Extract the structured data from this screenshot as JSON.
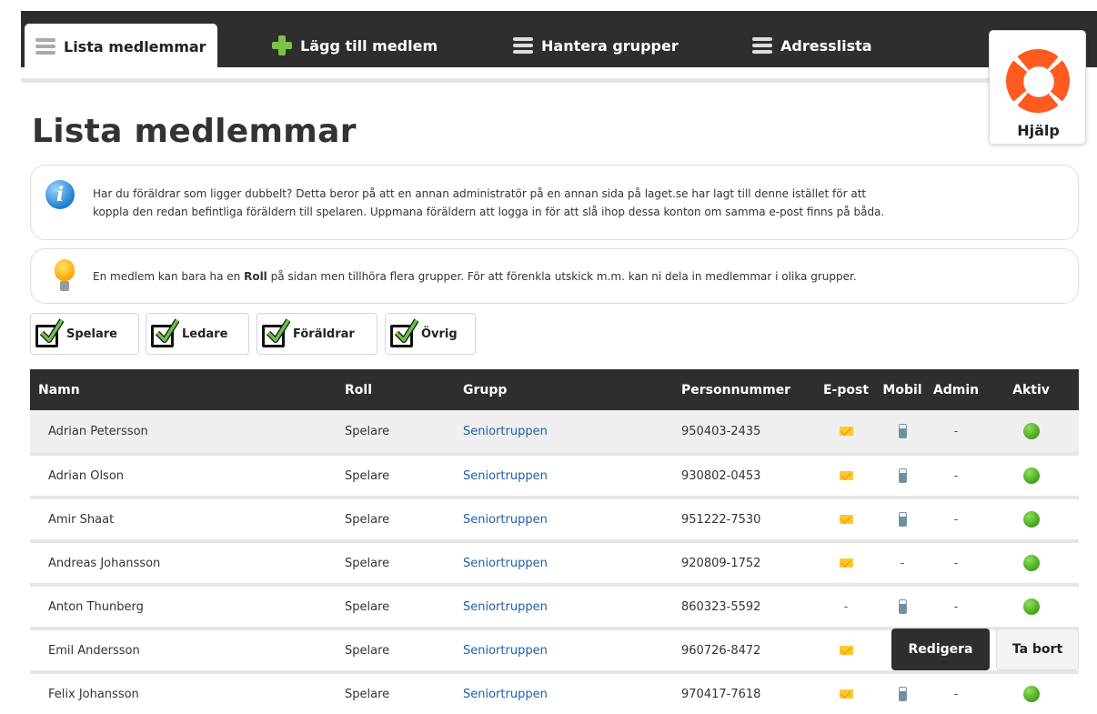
{
  "nav": {
    "tabs": [
      {
        "label": "Lista medlemmar",
        "icon": "list-icon"
      },
      {
        "label": "Lägg till medlem",
        "icon": "plus-icon"
      },
      {
        "label": "Hantera grupper",
        "icon": "list-icon"
      },
      {
        "label": "Adresslista",
        "icon": "list-icon"
      }
    ]
  },
  "help": {
    "label": "Hjälp",
    "icon": "lifebuoy-icon"
  },
  "page": {
    "title": "Lista medlemmar"
  },
  "notices": {
    "info": {
      "line1": "Har du föräldrar som ligger dubbelt? Detta beror på att en annan administratör på en annan sida på laget.se har lagt till denne istället för att",
      "line2": "koppla den redan befintliga föräldern till spelaren. Uppmana föräldern att logga in för att slå ihop dessa konton om samma e-post finns på båda."
    },
    "tip": {
      "before": "En medlem kan bara ha en ",
      "bold": "Roll",
      "after": " på sidan men tillhöra flera grupper. För att förenkla utskick m.m. kan ni dela in medlemmar i olika grupper."
    }
  },
  "filters": [
    "Spelare",
    "Ledare",
    "Föräldrar",
    "Övrig"
  ],
  "table": {
    "headers": {
      "name": "Namn",
      "roll": "Roll",
      "grupp": "Grupp",
      "pnr": "Personnummer",
      "epost": "E-post",
      "mobil": "Mobil",
      "admin": "Admin",
      "aktiv": "Aktiv"
    },
    "rows": [
      {
        "name": "Adrian Petersson",
        "roll": "Spelare",
        "grupp": "Seniortruppen",
        "pnr": "950403-2435",
        "epost": "envelope-icon",
        "mobil": "phone-icon",
        "admin": "-",
        "aktiv": "green-dot-icon"
      },
      {
        "name": "Adrian Olson",
        "roll": "Spelare",
        "grupp": "Seniortruppen",
        "pnr": "930802-0453",
        "epost": "envelope-icon",
        "mobil": "phone-icon",
        "admin": "-",
        "aktiv": "green-dot-icon"
      },
      {
        "name": "Amir Shaat",
        "roll": "Spelare",
        "grupp": "Seniortruppen",
        "pnr": "951222-7530",
        "epost": "envelope-icon",
        "mobil": "phone-icon",
        "admin": "-",
        "aktiv": "green-dot-icon"
      },
      {
        "name": "Andreas Johansson",
        "roll": "Spelare",
        "grupp": "Seniortruppen",
        "pnr": "920809-1752",
        "epost": "envelope-icon",
        "mobil": "-",
        "admin": "-",
        "aktiv": "green-dot-icon"
      },
      {
        "name": "Anton Thunberg",
        "roll": "Spelare",
        "grupp": "Seniortruppen",
        "pnr": "860323-5592",
        "epost": "-",
        "mobil": "phone-icon",
        "admin": "-",
        "aktiv": "green-dot-icon"
      },
      {
        "name": "Emil Andersson",
        "roll": "Spelare",
        "grupp": "Seniortruppen",
        "pnr": "960726-8472",
        "epost": "envelope-icon",
        "mobil": "",
        "admin": "",
        "aktiv": ""
      },
      {
        "name": "Felix Johansson",
        "roll": "Spelare",
        "grupp": "Seniortruppen",
        "pnr": "970417-7618",
        "epost": "envelope-icon",
        "mobil": "phone-icon",
        "admin": "-",
        "aktiv": "green-dot-icon"
      }
    ],
    "row_actions": {
      "edit": "Redigera",
      "delete": "Ta bort"
    }
  },
  "colors": {
    "nav_bg": "#2e2e2e",
    "link": "#1f5fa8",
    "accent_green": "#7dc242",
    "help_orange": "#ff5a1f"
  }
}
